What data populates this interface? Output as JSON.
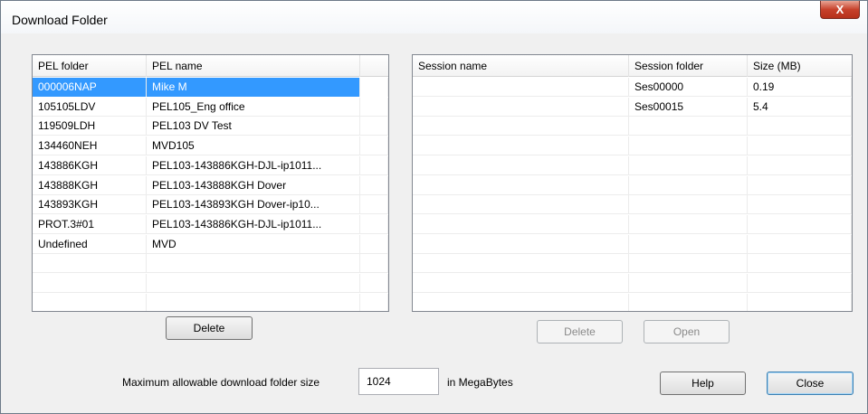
{
  "window": {
    "title": "Download Folder",
    "close_glyph": "X"
  },
  "pel_list": {
    "columns": [
      "PEL folder",
      "PEL name"
    ],
    "rows": [
      [
        "000006NAP",
        "Mike M"
      ],
      [
        "105105LDV",
        "PEL105_Eng office"
      ],
      [
        "119509LDH",
        "PEL103 DV Test"
      ],
      [
        "134460NEH",
        "MVD105"
      ],
      [
        "143886KGH",
        "PEL103-143886KGH-DJL-ip1011..."
      ],
      [
        "143888KGH",
        "PEL103-143888KGH Dover"
      ],
      [
        "143893KGH",
        "PEL103-143893KGH Dover-ip10..."
      ],
      [
        "PROT.3#01",
        "PEL103-143886KGH-DJL-ip1011..."
      ],
      [
        "Undefined",
        "MVD"
      ]
    ],
    "selected_index": 0
  },
  "session_list": {
    "columns": [
      "Session name",
      "Session folder",
      "Size (MB)"
    ],
    "rows": [
      [
        "",
        "Ses00000",
        "0.19"
      ],
      [
        "",
        "Ses00015",
        "5.4"
      ]
    ]
  },
  "buttons": {
    "pel_delete": "Delete",
    "session_delete": "Delete",
    "session_open": "Open",
    "help": "Help",
    "close": "Close"
  },
  "folder_size": {
    "label": "Maximum allowable download folder size",
    "value": "1024",
    "unit": "in MegaBytes"
  }
}
